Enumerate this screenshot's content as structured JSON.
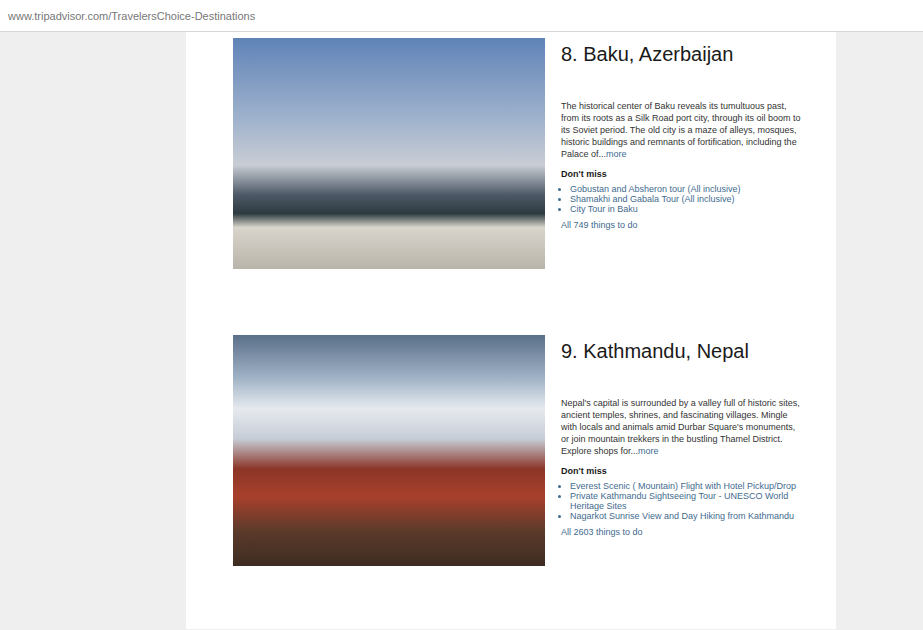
{
  "browser": {
    "url": "www.tripadvisor.com/TravelersChoice-Destinations"
  },
  "destinations": [
    {
      "title": "8. Baku, Azerbaijan",
      "description": "The historical center of Baku reveals its tumultuous past, from its roots as a Silk Road port city, through its oil boom to its Soviet period. The old city is a maze of alleys, mosques, historic buildings and remnants of fortification, including the Palace of...",
      "more": "more",
      "dont_miss_label": "Don't miss",
      "links": [
        "Gobustan and Absheron tour (All inclusive)",
        "Shamakhi and Gabala Tour (All inclusive)",
        "City Tour in Baku"
      ],
      "all_things": "All 749 things to do"
    },
    {
      "title": "9. Kathmandu, Nepal",
      "description": "Nepal's capital is surrounded by a valley full of historic sites, ancient temples, shrines, and fascinating villages. Mingle with locals and animals amid Durbar Square's monuments, or join mountain trekkers in the bustling Thamel District. Explore shops for...",
      "more": "more",
      "dont_miss_label": "Don't miss",
      "links": [
        "Everest Scenic ( Mountain) Flight with Hotel Pickup/Drop",
        "Private Kathmandu Sightseeing Tour - UNESCO World Heritage Sites",
        "Nagarkot Sunrise View and Day Hiking from Kathmandu"
      ],
      "all_things": "All 2603 things to do"
    }
  ]
}
